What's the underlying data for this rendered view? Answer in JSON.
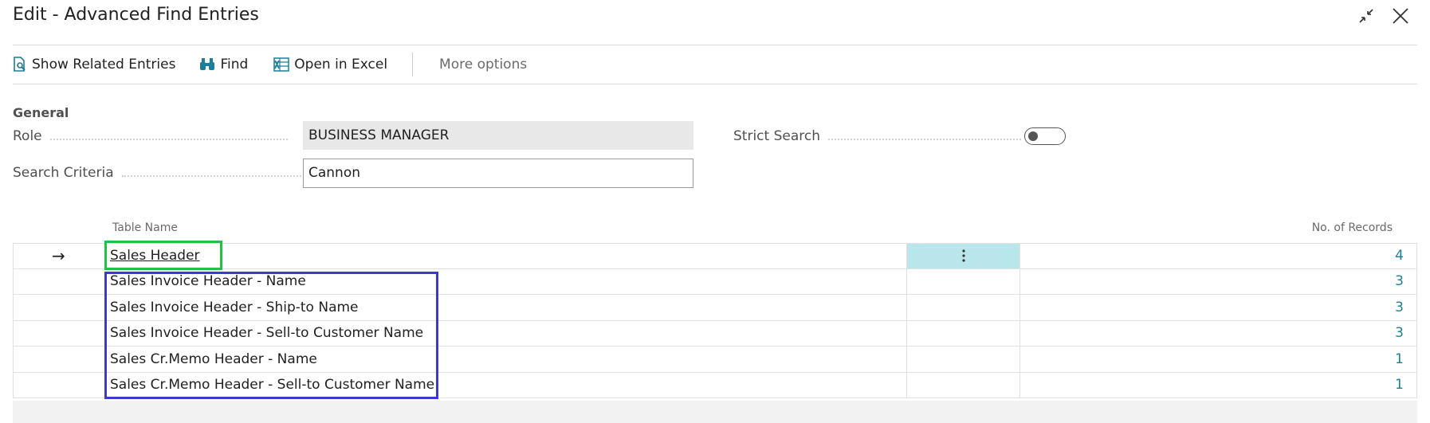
{
  "window": {
    "title": "Edit - Advanced Find Entries",
    "collapse_icon": "collapse-arrows-icon",
    "close_icon": "close-icon"
  },
  "actions": {
    "show_related": "Show Related Entries",
    "find": "Find",
    "open_excel": "Open in Excel",
    "more_options": "More options"
  },
  "general": {
    "section_title": "General",
    "role_label": "Role",
    "role_value": "BUSINESS MANAGER",
    "criteria_label": "Search Criteria",
    "criteria_value": "Cannon",
    "strict_label": "Strict Search",
    "strict_on": false
  },
  "table": {
    "col_name": "Table Name",
    "col_records": "No. of Records",
    "rows": [
      {
        "name": "Sales Header",
        "records": "4",
        "current": true
      },
      {
        "name": "Sales Invoice Header - Name",
        "records": "3"
      },
      {
        "name": "Sales Invoice Header - Ship-to Name",
        "records": "3"
      },
      {
        "name": "Sales Invoice Header - Sell-to Customer Name",
        "records": "3"
      },
      {
        "name": "Sales Cr.Memo Header - Name",
        "records": "1"
      },
      {
        "name": "Sales Cr.Memo Header - Sell-to Customer Name",
        "records": "1"
      }
    ],
    "row_arrow": "→",
    "row_menu_icon": "vertical-ellipsis-icon"
  },
  "colors": {
    "link": "#1a7f9a",
    "selected_cell": "#b8e6ea",
    "highlight_green": "#22c145",
    "highlight_blue": "#3a3acb"
  }
}
